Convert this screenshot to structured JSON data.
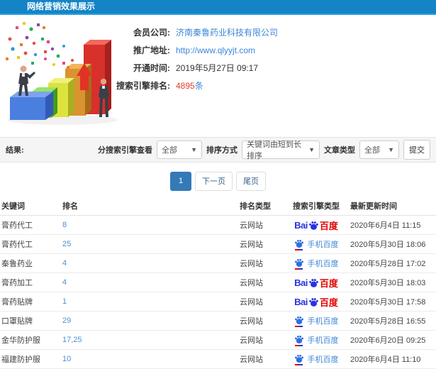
{
  "header": {
    "title": "网络营销效果展示"
  },
  "info": {
    "company_label": "会员公司:",
    "company_value": "济南秦鲁药业科技有限公司",
    "url_label": "推广地址:",
    "url_value": "http://www.qlyyjt.com",
    "opened_label": "开通时间:",
    "opened_value": "2019年5月27日 09:17",
    "rank_label": "搜索引擎排名:",
    "rank_value": "4895",
    "rank_unit": "条"
  },
  "filters": {
    "result_label": "结果:",
    "engine_view_label": "分搜索引擎查看",
    "engine_view_value": "全部",
    "sort_label": "排序方式",
    "sort_value": "关键词由短到长排序",
    "article_type_label": "文章类型",
    "article_type_value": "全部",
    "submit_label": "提交",
    "caret": "▼"
  },
  "pagination": {
    "current": "1",
    "next": "下一页",
    "last": "尾页"
  },
  "table": {
    "headers": [
      "关键词",
      "排名",
      "排名类型",
      "搜索引擎类型",
      "最新更新时间"
    ],
    "engine_labels": {
      "baidu_en": "Bai",
      "baidu_cn": "百度",
      "mobile": "手机百度"
    },
    "rows": [
      {
        "keyword": "膏药代工",
        "rank": "8",
        "rank_type": "云网站",
        "engine": "baidu",
        "updated": "2020年6月4日 11:15"
      },
      {
        "keyword": "膏药代工",
        "rank": "25",
        "rank_type": "云网站",
        "engine": "mobile",
        "updated": "2020年5月30日 18:06"
      },
      {
        "keyword": "秦鲁药业",
        "rank": "4",
        "rank_type": "云网站",
        "engine": "mobile",
        "updated": "2020年5月28日 17:02"
      },
      {
        "keyword": "膏药加工",
        "rank": "4",
        "rank_type": "云网站",
        "engine": "baidu",
        "updated": "2020年5月30日 18:03"
      },
      {
        "keyword": "膏药贴牌",
        "rank": "1",
        "rank_type": "云网站",
        "engine": "baidu",
        "updated": "2020年5月30日 17:58"
      },
      {
        "keyword": "口罩贴牌",
        "rank": "29",
        "rank_type": "云网站",
        "engine": "mobile",
        "updated": "2020年5月28日 16:55"
      },
      {
        "keyword": "金华防护服",
        "rank": "17,25",
        "rank_type": "云网站",
        "engine": "mobile",
        "updated": "2020年6月20日 09:25"
      },
      {
        "keyword": "福建防护服",
        "rank": "10",
        "rank_type": "云网站",
        "engine": "mobile",
        "updated": "2020年6月4日 11:10"
      }
    ]
  },
  "colors": {
    "header_bg": "#1484c6",
    "link_blue": "#3d86d8",
    "highlight_red": "#e43d30",
    "active_page": "#337ab7",
    "baidu_blue": "#2932e1",
    "baidu_red": "#e10602"
  }
}
